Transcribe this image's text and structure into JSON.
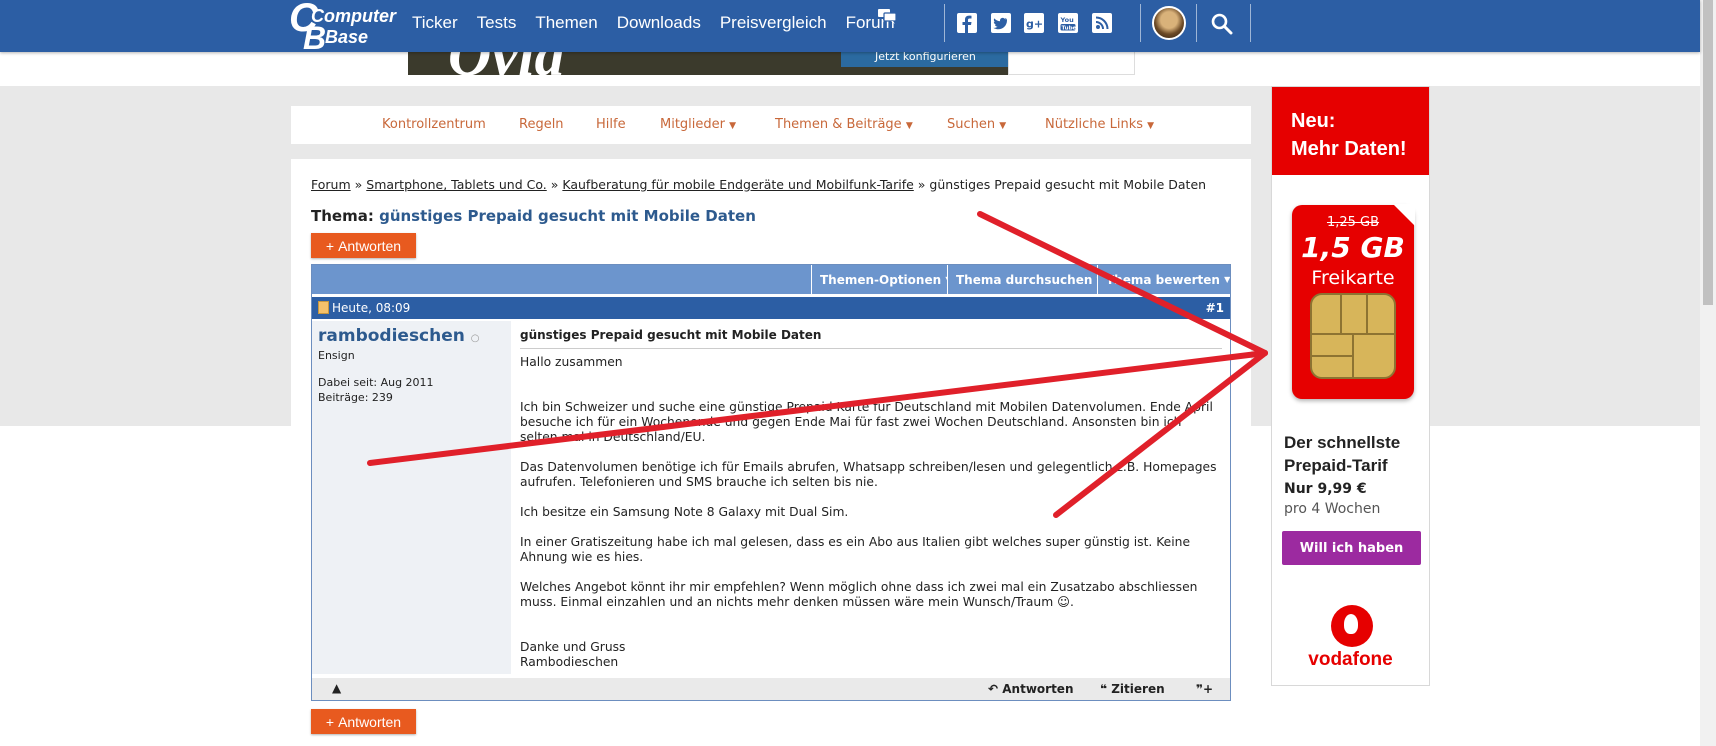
{
  "nav": {
    "logo_line1": "Computer",
    "logo_line2": "Base",
    "links": [
      "Ticker",
      "Tests",
      "Themen",
      "Downloads",
      "Preisvergleich",
      "Forum"
    ]
  },
  "top_ad": {
    "headline": "Ovid",
    "pill_text": "Jetzt konfigurieren"
  },
  "subnav": {
    "items": [
      "Kontrollzentrum",
      "Regeln",
      "Hilfe",
      "Mitglieder",
      "Themen & Beiträge",
      "Suchen",
      "Nützliche Links"
    ]
  },
  "breadcrumb": {
    "forum": "Forum",
    "cat1": "Smartphone, Tablets und Co.",
    "cat2": "Kaufberatung für mobile Endgeräte und Mobilfunk-Tarife",
    "current": "günstiges Prepaid gesucht mit Mobile Daten",
    "sep": "»"
  },
  "thread": {
    "label": "Thema:",
    "title": "günstiges Prepaid gesucht mit Mobile Daten",
    "reply_label": "Antworten",
    "options": [
      "Themen-Optionen",
      "Thema durchsuchen",
      "Thema bewerten"
    ]
  },
  "post": {
    "date": "Heute, 08:09",
    "number": "#1",
    "username": "rambodieschen",
    "rank": "Ensign",
    "joined": "Dabei seit: Aug 2011",
    "posts": "Beiträge: 239",
    "title": "günstiges Prepaid gesucht mit Mobile Daten",
    "p1": "Hallo zusammen",
    "p2": "Ich bin Schweizer und suche eine günstige Prepaid Karte für Deutschland mit Mobilen Datenvolumen. Ende April besuche ich für ein Wochenende und gegen Ende Mai für fast zwei Wochen Deutschland. Ansonsten bin ich selten mal in Deutschland/EU.",
    "p3": "Das Datenvolumen benötige ich für Emails abrufen, Whatsapp schreiben/lesen und gelegentlich z.B. Homepages aufrufen. Telefonieren und SMS brauche ich selten bis nie.",
    "p4": "Ich besitze ein Samsung Note 8 Galaxy mit Dual Sim.",
    "p5": "In einer Gratiszeitung habe ich mal gelesen, dass es ein Abo aus Italien gibt welches super günstig ist. Keine Ahnung wie es hies.",
    "p6": "Welches Angebot könnt ihr mir empfehlen? Wenn möglich ohne dass ich zwei mal ein Zusatzabo abschliessen muss. Einmal einzahlen und an nichts mehr denken müssen wäre mein Wunsch/Traum",
    "p7a": "Danke und Gruss",
    "p7b": "Rambodieschen",
    "footer_reply": "Antworten",
    "footer_quote": "Zitieren"
  },
  "ad": {
    "badge_line1": "Neu:",
    "badge_line2": "Mehr Daten!",
    "old_value": "1,25 GB",
    "new_value": "1,5 GB",
    "product": "Freikarte",
    "headline_1": "Der schnellste",
    "headline_2": "Prepaid-Tarif",
    "price": "Nur 9,99 €",
    "period": "pro 4 Wochen",
    "cta": "Will ich haben",
    "brand": "vodafone"
  },
  "colors": {
    "nav_bg": "#2c5ea4",
    "accent_orange": "#e85a1f",
    "subnav_link": "#c8683a",
    "annotation_red": "#e0202a",
    "vodafone_red": "#e60000",
    "cta_purple": "#9c2aa0"
  }
}
